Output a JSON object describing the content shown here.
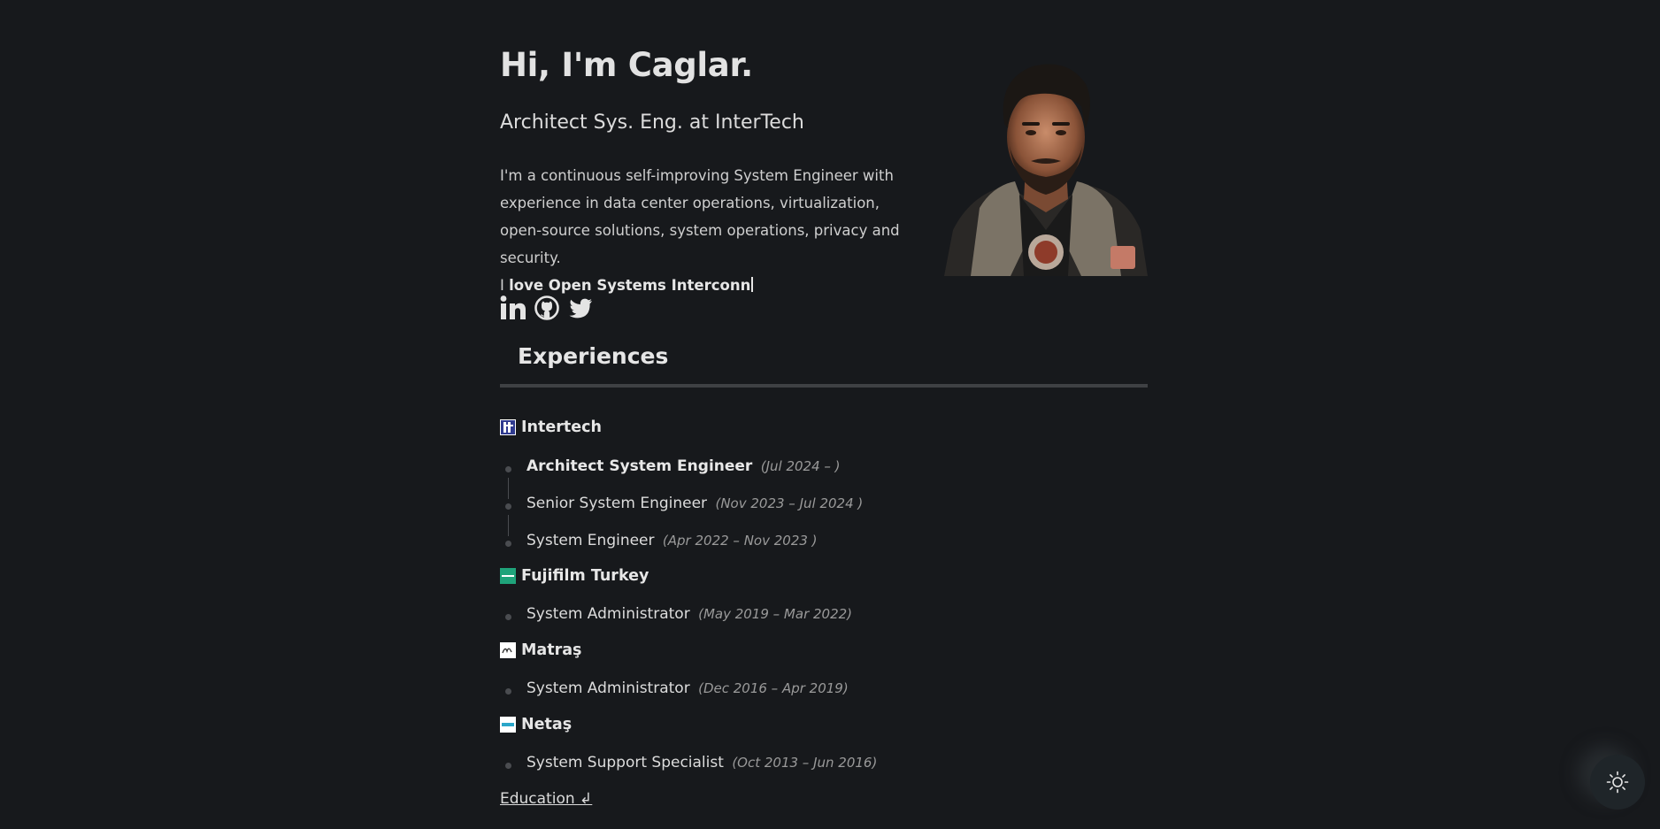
{
  "hero": {
    "title": "Hi, I'm Caglar.",
    "subtitle": "Architect Sys. Eng. at InterTech",
    "bio": "I'm a continuous self-improving System Engineer with experience in data center operations, virtualization, open-source solutions, system operations, privacy and security.",
    "typing_prefix": "I",
    "typing_text": "love Open Systems Interconn"
  },
  "social": {
    "icons": [
      "linkedin-icon",
      "github-icon",
      "twitter-icon"
    ]
  },
  "experiences": {
    "title": "Experiences",
    "companies": [
      {
        "name": "Intertech",
        "logo_color": "#2f3a8f",
        "roles": [
          {
            "title": "Architect System Engineer",
            "dates": "(Jul 2024 – )"
          },
          {
            "title": "Senior System Engineer",
            "dates": "(Nov 2023 – Jul 2024 )"
          },
          {
            "title": "System Engineer",
            "dates": "(Apr 2022 – Nov 2023 )"
          }
        ]
      },
      {
        "name": "Fujifilm Turkey",
        "logo_color": "#1fa37a",
        "roles": [
          {
            "title": "System Administrator",
            "dates": "(May 2019 – Mar 2022)"
          }
        ]
      },
      {
        "name": "Matraş",
        "logo_color": "#ffffff",
        "roles": [
          {
            "title": "System Administrator",
            "dates": "(Dec 2016 – Apr 2019)"
          }
        ]
      },
      {
        "name": "Netaş",
        "logo_color": "#ffffff",
        "roles": [
          {
            "title": "System Support Specialist",
            "dates": "(Oct 2013 – Jun 2016)"
          }
        ]
      }
    ]
  },
  "education_link": "Education ↲",
  "colors": {
    "background": "#17191c",
    "text": "#d8d8d8",
    "muted": "#9a9a9a",
    "rule": "#3f4144"
  }
}
